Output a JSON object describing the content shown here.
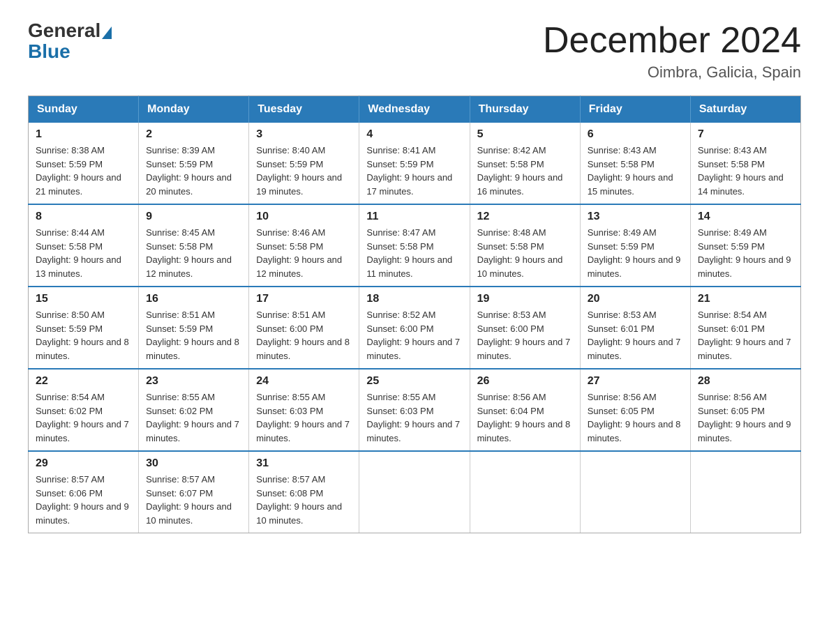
{
  "logo": {
    "general": "General",
    "blue": "Blue"
  },
  "header": {
    "title": "December 2024",
    "subtitle": "Oimbra, Galicia, Spain"
  },
  "weekdays": [
    "Sunday",
    "Monday",
    "Tuesday",
    "Wednesday",
    "Thursday",
    "Friday",
    "Saturday"
  ],
  "weeks": [
    [
      {
        "day": "1",
        "sunrise": "8:38 AM",
        "sunset": "5:59 PM",
        "daylight": "9 hours and 21 minutes."
      },
      {
        "day": "2",
        "sunrise": "8:39 AM",
        "sunset": "5:59 PM",
        "daylight": "9 hours and 20 minutes."
      },
      {
        "day": "3",
        "sunrise": "8:40 AM",
        "sunset": "5:59 PM",
        "daylight": "9 hours and 19 minutes."
      },
      {
        "day": "4",
        "sunrise": "8:41 AM",
        "sunset": "5:59 PM",
        "daylight": "9 hours and 17 minutes."
      },
      {
        "day": "5",
        "sunrise": "8:42 AM",
        "sunset": "5:58 PM",
        "daylight": "9 hours and 16 minutes."
      },
      {
        "day": "6",
        "sunrise": "8:43 AM",
        "sunset": "5:58 PM",
        "daylight": "9 hours and 15 minutes."
      },
      {
        "day": "7",
        "sunrise": "8:43 AM",
        "sunset": "5:58 PM",
        "daylight": "9 hours and 14 minutes."
      }
    ],
    [
      {
        "day": "8",
        "sunrise": "8:44 AM",
        "sunset": "5:58 PM",
        "daylight": "9 hours and 13 minutes."
      },
      {
        "day": "9",
        "sunrise": "8:45 AM",
        "sunset": "5:58 PM",
        "daylight": "9 hours and 12 minutes."
      },
      {
        "day": "10",
        "sunrise": "8:46 AM",
        "sunset": "5:58 PM",
        "daylight": "9 hours and 12 minutes."
      },
      {
        "day": "11",
        "sunrise": "8:47 AM",
        "sunset": "5:58 PM",
        "daylight": "9 hours and 11 minutes."
      },
      {
        "day": "12",
        "sunrise": "8:48 AM",
        "sunset": "5:58 PM",
        "daylight": "9 hours and 10 minutes."
      },
      {
        "day": "13",
        "sunrise": "8:49 AM",
        "sunset": "5:59 PM",
        "daylight": "9 hours and 9 minutes."
      },
      {
        "day": "14",
        "sunrise": "8:49 AM",
        "sunset": "5:59 PM",
        "daylight": "9 hours and 9 minutes."
      }
    ],
    [
      {
        "day": "15",
        "sunrise": "8:50 AM",
        "sunset": "5:59 PM",
        "daylight": "9 hours and 8 minutes."
      },
      {
        "day": "16",
        "sunrise": "8:51 AM",
        "sunset": "5:59 PM",
        "daylight": "9 hours and 8 minutes."
      },
      {
        "day": "17",
        "sunrise": "8:51 AM",
        "sunset": "6:00 PM",
        "daylight": "9 hours and 8 minutes."
      },
      {
        "day": "18",
        "sunrise": "8:52 AM",
        "sunset": "6:00 PM",
        "daylight": "9 hours and 7 minutes."
      },
      {
        "day": "19",
        "sunrise": "8:53 AM",
        "sunset": "6:00 PM",
        "daylight": "9 hours and 7 minutes."
      },
      {
        "day": "20",
        "sunrise": "8:53 AM",
        "sunset": "6:01 PM",
        "daylight": "9 hours and 7 minutes."
      },
      {
        "day": "21",
        "sunrise": "8:54 AM",
        "sunset": "6:01 PM",
        "daylight": "9 hours and 7 minutes."
      }
    ],
    [
      {
        "day": "22",
        "sunrise": "8:54 AM",
        "sunset": "6:02 PM",
        "daylight": "9 hours and 7 minutes."
      },
      {
        "day": "23",
        "sunrise": "8:55 AM",
        "sunset": "6:02 PM",
        "daylight": "9 hours and 7 minutes."
      },
      {
        "day": "24",
        "sunrise": "8:55 AM",
        "sunset": "6:03 PM",
        "daylight": "9 hours and 7 minutes."
      },
      {
        "day": "25",
        "sunrise": "8:55 AM",
        "sunset": "6:03 PM",
        "daylight": "9 hours and 7 minutes."
      },
      {
        "day": "26",
        "sunrise": "8:56 AM",
        "sunset": "6:04 PM",
        "daylight": "9 hours and 8 minutes."
      },
      {
        "day": "27",
        "sunrise": "8:56 AM",
        "sunset": "6:05 PM",
        "daylight": "9 hours and 8 minutes."
      },
      {
        "day": "28",
        "sunrise": "8:56 AM",
        "sunset": "6:05 PM",
        "daylight": "9 hours and 9 minutes."
      }
    ],
    [
      {
        "day": "29",
        "sunrise": "8:57 AM",
        "sunset": "6:06 PM",
        "daylight": "9 hours and 9 minutes."
      },
      {
        "day": "30",
        "sunrise": "8:57 AM",
        "sunset": "6:07 PM",
        "daylight": "9 hours and 10 minutes."
      },
      {
        "day": "31",
        "sunrise": "8:57 AM",
        "sunset": "6:08 PM",
        "daylight": "9 hours and 10 minutes."
      },
      null,
      null,
      null,
      null
    ]
  ]
}
